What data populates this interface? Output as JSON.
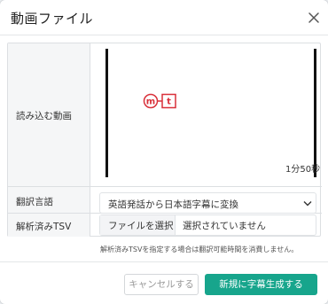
{
  "dialog": {
    "title": "動画ファイル",
    "close_icon": "close-icon"
  },
  "form": {
    "video": {
      "label": "読み込む動画",
      "duration": "1分50秒",
      "logo_letters": [
        "m",
        "t"
      ]
    },
    "translation": {
      "label": "翻訳言語",
      "selected": "英語発話から日本語字幕に変換",
      "icon": "chevron-down-icon"
    },
    "tsv": {
      "label": "解析済みTSV",
      "choose_button": "ファイルを選択",
      "status": "選択されていません"
    }
  },
  "note": "解析済みTSVを指定する場合は翻訳可能時間を消費しません。",
  "footer": {
    "cancel_label": "キャンセルする",
    "create_label": "新規に字幕生成する"
  },
  "colors": {
    "accent": "#17a58c",
    "logo_red": "#d9303a"
  }
}
